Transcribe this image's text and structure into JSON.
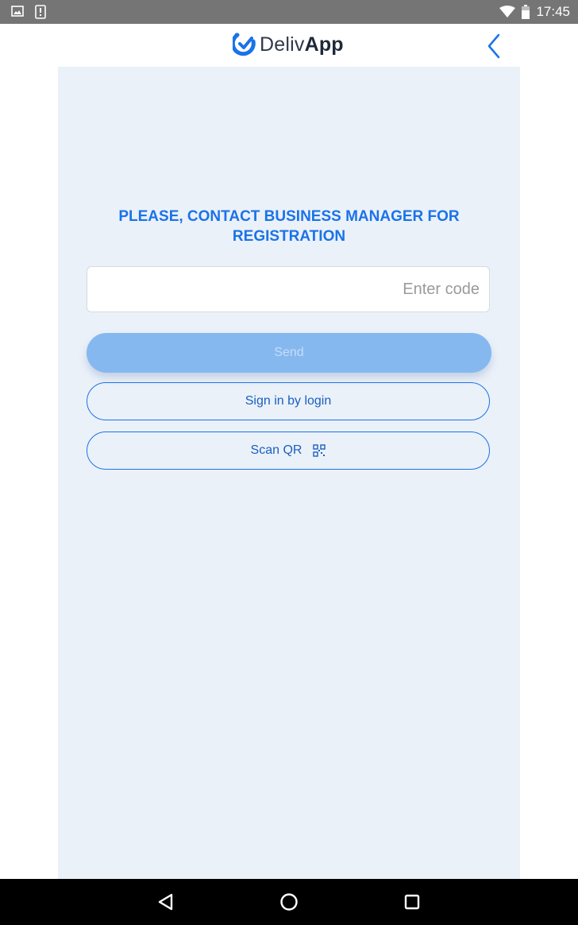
{
  "status_bar": {
    "time": "17:45",
    "icons": [
      "image-icon",
      "alert-icon",
      "wifi-icon",
      "battery-icon"
    ]
  },
  "header": {
    "logo_light": "Deliv",
    "logo_bold": "App",
    "logo_icon": "delivapp-logo-icon",
    "back_icon": "chevron-left-icon"
  },
  "main": {
    "headline_line1": "PLEASE, CONTACT BUSINESS MANAGER FOR",
    "headline_line2": "REGISTRATION",
    "code_input": {
      "value": "",
      "placeholder": "Enter code"
    },
    "send_label": "Send",
    "login_label": "Sign in by login",
    "scan_label": "Scan QR",
    "scan_icon": "qr-code-icon"
  },
  "nav_bar": {
    "icons": [
      "back-triangle-icon",
      "home-circle-icon",
      "recents-square-icon"
    ]
  },
  "colors": {
    "accent": "#1a73e8",
    "send_disabled": "#86b8f0",
    "content_bg": "#ebf1f9",
    "status_bar": "#757575"
  }
}
